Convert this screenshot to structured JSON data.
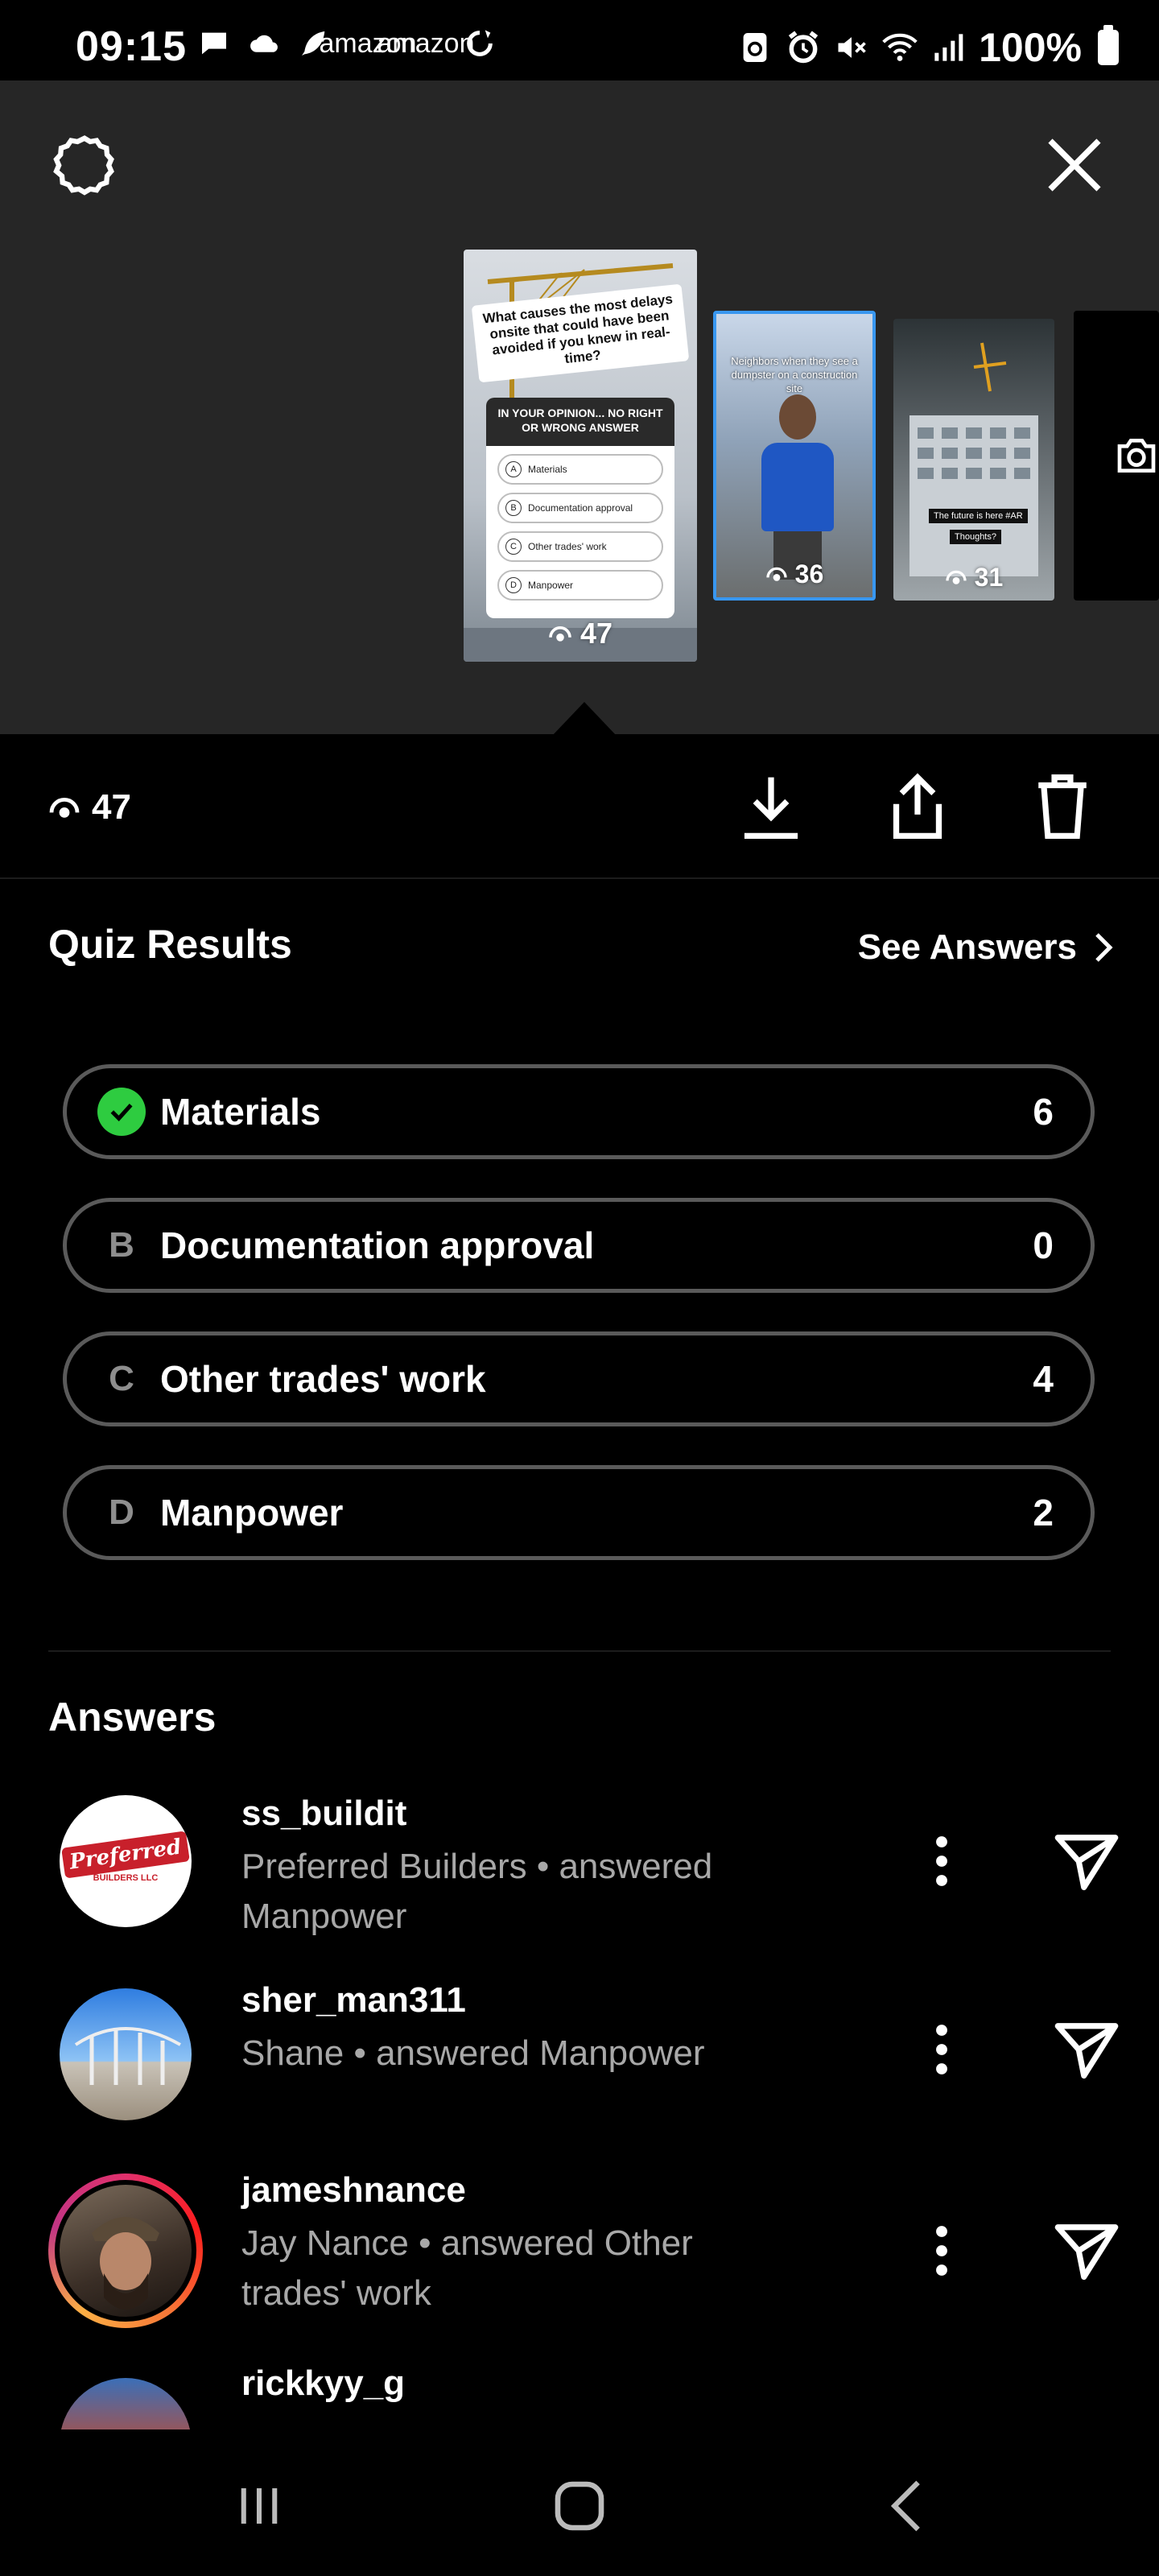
{
  "status_bar": {
    "time": "09:15",
    "left_icons": [
      "message-icon",
      "cloud-icon",
      "feather-icon",
      "amazon-icon",
      "amazon-icon",
      "sync-icon"
    ],
    "amazon_label": "amazon",
    "right_icons": [
      "recycle-icon",
      "alarm-icon",
      "mute-icon",
      "wifi-icon",
      "signal-icon"
    ],
    "battery": "100%"
  },
  "story_strip": {
    "main_thumb": {
      "question": "What causes the most delays onsite that could have been avoided if you knew in real-time?",
      "card_header": "IN YOUR OPINION... NO RIGHT OR WRONG ANSWER",
      "options": [
        {
          "letter": "A",
          "label": "Materials"
        },
        {
          "letter": "B",
          "label": "Documentation approval"
        },
        {
          "letter": "C",
          "label": "Other trades' work"
        },
        {
          "letter": "D",
          "label": "Manpower"
        }
      ],
      "views": "47"
    },
    "thumb2": {
      "text": "Neighbors when they see a dumpster on a construction site",
      "views": "36"
    },
    "thumb3": {
      "caption": "The future is here #AR",
      "caption2": "Thoughts?",
      "views": "31"
    }
  },
  "actions": {
    "views": "47",
    "icons": [
      "download-icon",
      "share-icon",
      "delete-icon"
    ]
  },
  "quiz_results": {
    "title": "Quiz Results",
    "see_answers": "See Answers",
    "options": [
      {
        "marker": "",
        "label": "Materials",
        "count": "6",
        "correct": true
      },
      {
        "marker": "B",
        "label": "Documentation approval",
        "count": "0",
        "correct": false
      },
      {
        "marker": "C",
        "label": "Other trades' work",
        "count": "4",
        "correct": false
      },
      {
        "marker": "D",
        "label": "Manpower",
        "count": "2",
        "correct": false
      }
    ],
    "correct_color": "#2ecc40"
  },
  "answers": {
    "title": "Answers",
    "items": [
      {
        "username": "ss_buildit",
        "sub": "Preferred Builders • answered Manpower",
        "avatar_text": "Preferred",
        "avatar_sub": "BUILDERS LLC"
      },
      {
        "username": "sher_man311",
        "sub": "Shane • answered Manpower"
      },
      {
        "username": "jameshnance",
        "sub": "Jay Nance • answered Other trades' work"
      },
      {
        "username": "rickkyy_g",
        "sub": ""
      }
    ]
  },
  "nav": {
    "icons": [
      "recents-icon",
      "home-icon",
      "back-icon"
    ]
  }
}
